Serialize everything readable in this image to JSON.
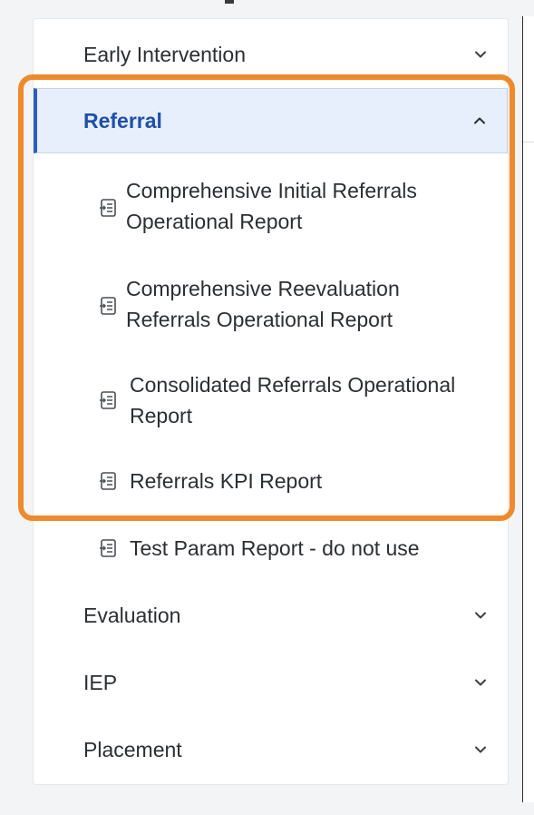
{
  "sidebar": {
    "sections": [
      {
        "label": "Early Intervention",
        "icon": "chevron-down-icon"
      },
      {
        "label": "Referral",
        "icon": "chevron-up-icon",
        "expanded": true
      },
      {
        "label": "Evaluation",
        "icon": "chevron-down-icon"
      },
      {
        "label": "IEP",
        "icon": "chevron-down-icon"
      },
      {
        "label": "Placement",
        "icon": "chevron-down-icon"
      }
    ],
    "referral_reports": [
      {
        "line1": "Comprehensive Initial Referrals",
        "line2": "Operational Report",
        "icon": "report-document-icon"
      },
      {
        "line1": "Comprehensive Reevaluation",
        "line2": "Referrals Operational Report",
        "icon": "report-document-icon"
      },
      {
        "line1": "Consolidated Referrals Operational",
        "line2": "Report",
        "icon": "report-document-icon"
      },
      {
        "line1": "Referrals KPI Report",
        "icon": "report-document-icon"
      },
      {
        "line1": "Test Param Report - do not use",
        "icon": "report-document-icon"
      }
    ]
  },
  "colors": {
    "highlight_border": "#ef8a2c",
    "selected_background": "#e6effb",
    "selected_text": "#1f4fa8",
    "selected_accent": "#2f5db8"
  }
}
